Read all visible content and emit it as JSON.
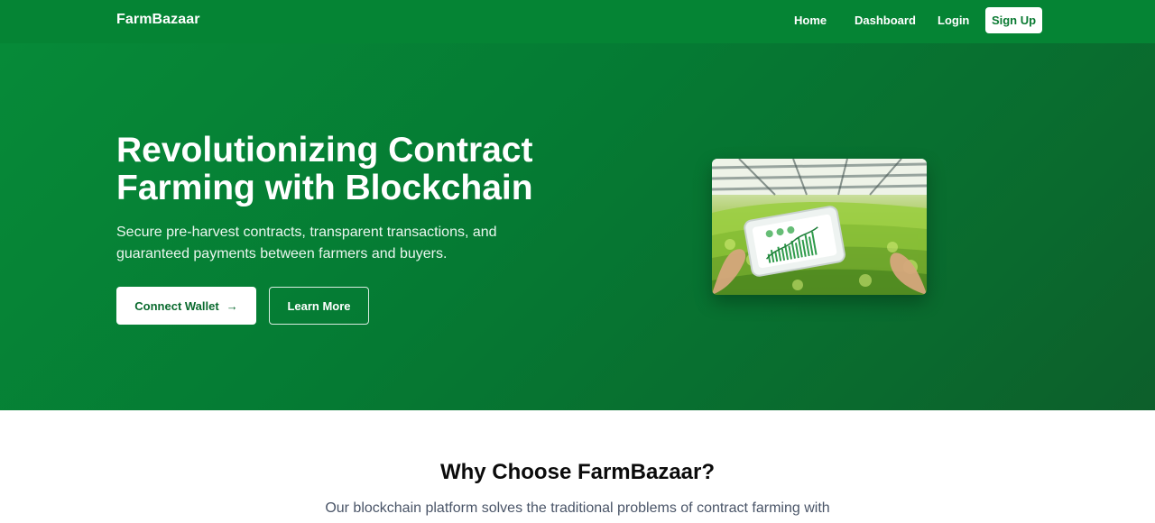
{
  "nav": {
    "brand": "FarmBazaar",
    "links": [
      "Home",
      "Dashboard",
      "Login"
    ],
    "signup_label": "Sign Up"
  },
  "hero": {
    "title": "Revolutionizing Contract Farming with Blockchain",
    "subtitle": "Secure pre-harvest contracts, transparent transactions, and guaranteed payments between farmers and buyers.",
    "primary_button": "Connect Wallet",
    "secondary_button": "Learn More",
    "image_icon": "greenhouse-tablet-chart-image"
  },
  "why": {
    "title": "Why Choose FarmBazaar?",
    "subtitle": "Our blockchain platform solves the traditional problems of contract farming with"
  },
  "colors": {
    "nav_bg": "#058434",
    "hero_bg_start": "#068a38",
    "hero_bg_end": "#0d5f2b",
    "accent_text": "#0a6a2e"
  }
}
